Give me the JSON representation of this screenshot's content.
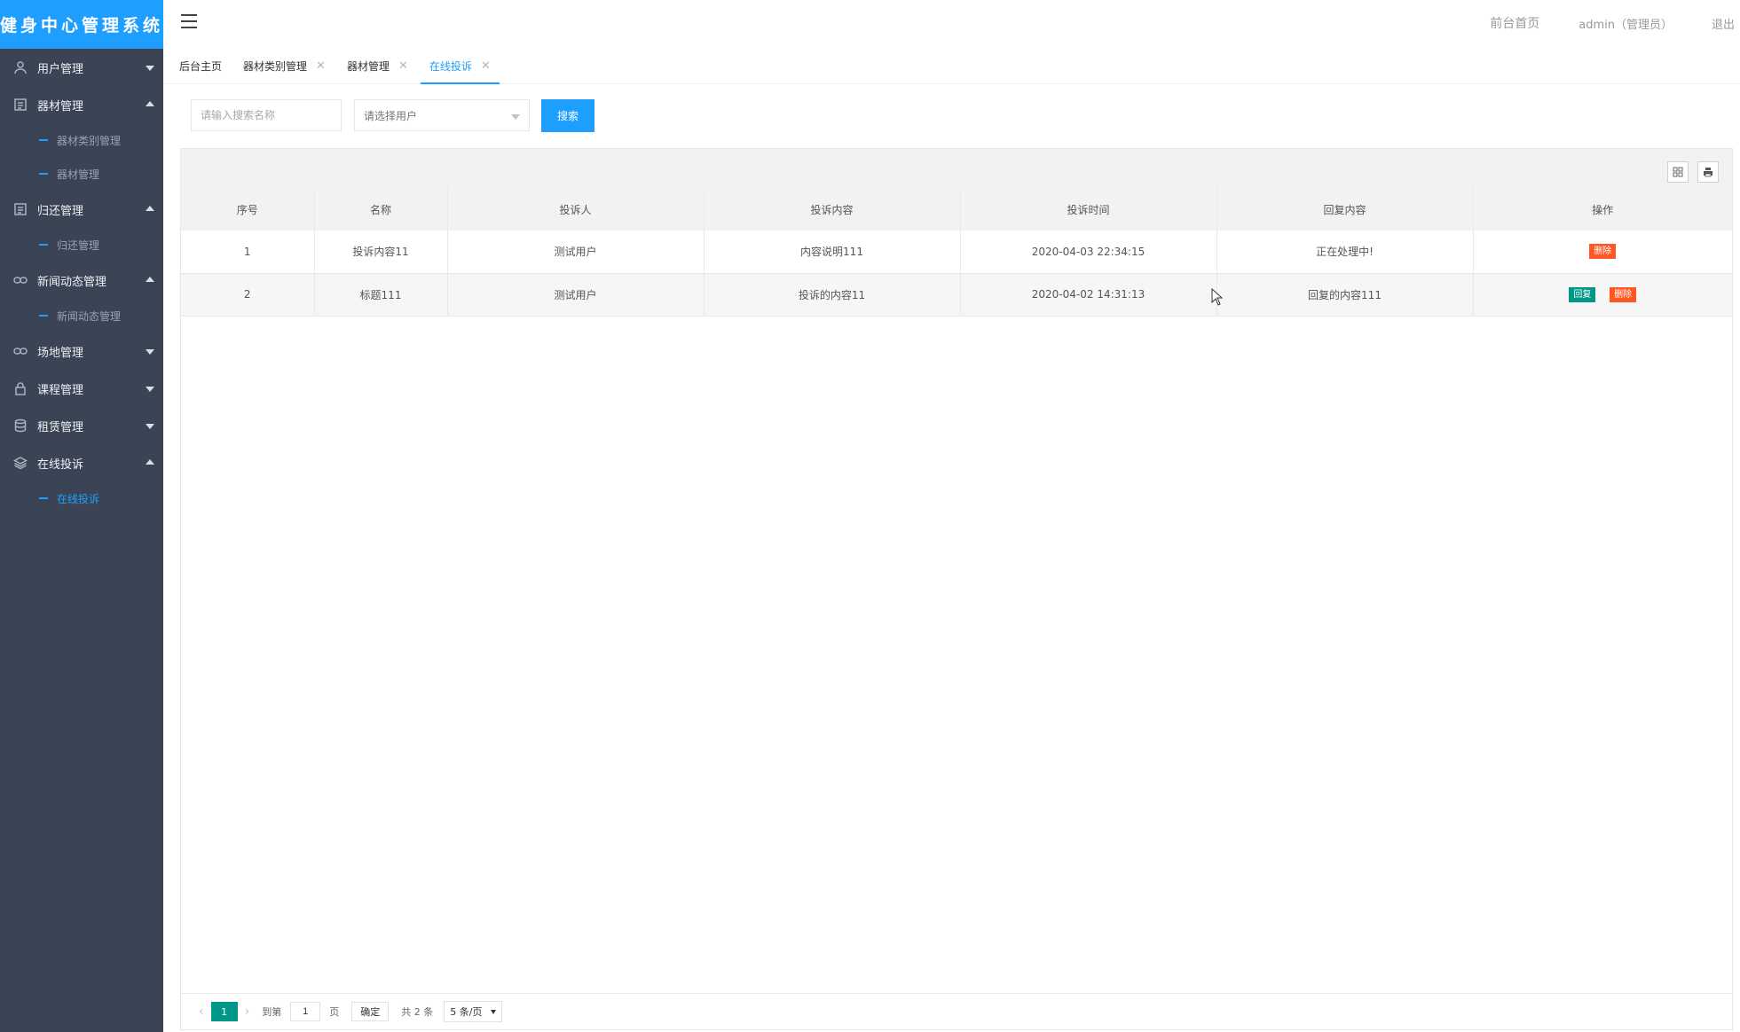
{
  "brand": {
    "title": "健身中心管理系统"
  },
  "sidebar": {
    "groups": [
      {
        "label": "用户管理",
        "icon": "user-icon",
        "expanded": false,
        "items": []
      },
      {
        "label": "器材管理",
        "icon": "list-icon",
        "expanded": true,
        "items": [
          {
            "label": "器材类别管理"
          },
          {
            "label": "器材管理"
          }
        ]
      },
      {
        "label": "归还管理",
        "icon": "list-icon",
        "expanded": true,
        "items": [
          {
            "label": "归还管理"
          }
        ]
      },
      {
        "label": "新闻动态管理",
        "icon": "link-icon",
        "expanded": true,
        "items": [
          {
            "label": "新闻动态管理"
          }
        ]
      },
      {
        "label": "场地管理",
        "icon": "link-icon",
        "expanded": false,
        "items": []
      },
      {
        "label": "课程管理",
        "icon": "lock-icon",
        "expanded": false,
        "items": []
      },
      {
        "label": "租赁管理",
        "icon": "database-icon",
        "expanded": false,
        "items": []
      },
      {
        "label": "在线投诉",
        "icon": "layers-icon",
        "expanded": true,
        "items": [
          {
            "label": "在线投诉",
            "active": true
          }
        ]
      }
    ]
  },
  "header": {
    "front_home": "前台首页",
    "user": "admin（管理员）",
    "logout": "退出"
  },
  "tabs": [
    {
      "label": "后台主页",
      "closable": false
    },
    {
      "label": "器材类别管理",
      "closable": true
    },
    {
      "label": "器材管理",
      "closable": true
    },
    {
      "label": "在线投诉",
      "closable": true,
      "active": true
    }
  ],
  "toolbar": {
    "search_placeholder": "请输入搜索名称",
    "select_placeholder": "请选择用户",
    "search_label": "搜索"
  },
  "table": {
    "columns": [
      "序号",
      "名称",
      "投诉人",
      "投诉内容",
      "投诉时间",
      "回复内容",
      "操作"
    ],
    "rows": [
      {
        "index": "1",
        "name": "投诉内容11",
        "complainant": "测试用户",
        "content": "内容说明111",
        "time": "2020-04-03 22:34:15",
        "reply": "正在处理中!",
        "actions": [
          "删除"
        ]
      },
      {
        "index": "2",
        "name": "标题111",
        "complainant": "测试用户",
        "content": "投诉的内容11",
        "time": "2020-04-02 14:31:13",
        "reply": "回复的内容111",
        "actions": [
          "回复",
          "删除"
        ]
      }
    ]
  },
  "pager": {
    "current": "1",
    "goto_label": "到第",
    "goto_value": "1",
    "page_unit": "页",
    "confirm": "确定",
    "total": "共 2 条",
    "page_size": "5 条/页"
  },
  "colors": {
    "sidebar_bg": "#3b4455",
    "accent": "#1e9fff",
    "reply": "#009688",
    "delete": "#ff5722"
  }
}
